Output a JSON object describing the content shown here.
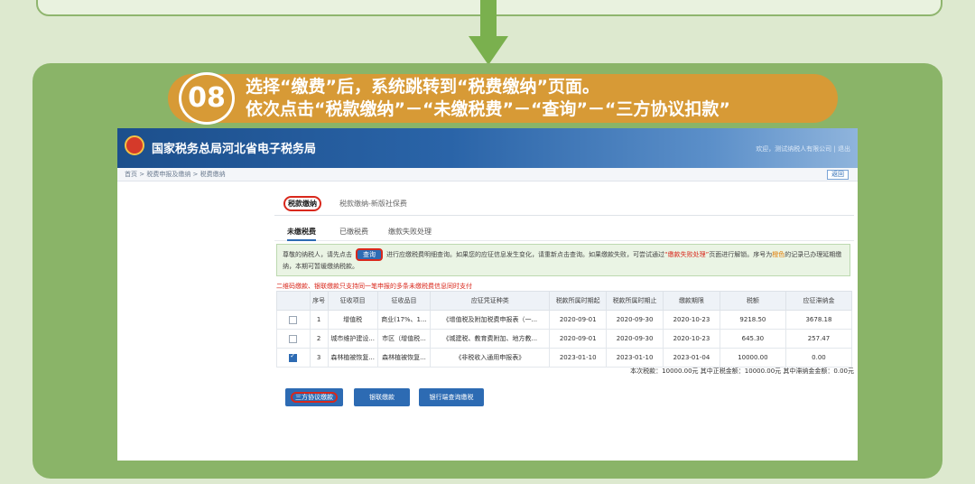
{
  "step": {
    "number": "08",
    "line1": "选择“缴费”后，系统跳转到“税费缴纳”页面。",
    "line2": "依次点击“税款缴纳”－“未缴税费”－“查询”－“三方协议扣款”"
  },
  "header": {
    "title": "国家税务总局河北省电子税务局",
    "user_info": "欢迎，测试纳税人有限公司 | 退出"
  },
  "breadcrumb": {
    "text": "首页 > 税费申报及缴纳 > 税费缴纳",
    "return_label": "返回"
  },
  "tabs_primary": [
    "税款缴纳",
    "税款缴纳-新版社保费"
  ],
  "tabs_secondary": [
    "未缴税费",
    "已缴税费",
    "缴款失败处理"
  ],
  "notice": {
    "part1": "尊敬的纳税人，请先点击",
    "query_button": "查询",
    "part2": "进行应缴税费明细查询。如果您的应征信息发生变化，请重新点击查询。如果缴款失败，可尝试通过",
    "link": "“缴款失败处理”",
    "part3": "页面进行解锁。序号为",
    "highlight": "橙色",
    "part4": "的记录已办理延期缴纳，本期可暂缓缴纳税款。"
  },
  "warning": "二维码缴款、银联缴款只支持同一笔申报的多条未缴税费信息同时支付",
  "table": {
    "headers": [
      "",
      "序号",
      "征收项目",
      "征收品目",
      "应征凭证种类",
      "税款所属时期起",
      "税款所属时期止",
      "缴款期限",
      "税额",
      "应征滞纳金"
    ],
    "rows": [
      {
        "checked": false,
        "no": "1",
        "item": "增值税",
        "subitem": "商业(17%、1...",
        "voucher": "《增值税及附加税费申报表（一...",
        "start": "2020-09-01",
        "end": "2020-09-30",
        "deadline": "2020-10-23",
        "tax": "9218.50",
        "late_fee": "3678.18"
      },
      {
        "checked": false,
        "no": "2",
        "item": "城市维护建设...",
        "subitem": "市区（增值税...",
        "voucher": "《城建税、教育费附加、地方教...",
        "start": "2020-09-01",
        "end": "2020-09-30",
        "deadline": "2020-10-23",
        "tax": "645.30",
        "late_fee": "257.47"
      },
      {
        "checked": true,
        "no": "3",
        "item": "森林植被恢复...",
        "subitem": "森林植被恢复...",
        "voucher": "《非税收入通用申报表》",
        "start": "2023-01-10",
        "end": "2023-01-10",
        "deadline": "2023-01-04",
        "tax": "10000.00",
        "late_fee": "0.00"
      }
    ]
  },
  "summary": "本次税款：10000.00元  其中正税金额：10000.00元  其中滞纳金金额：0.00元",
  "buttons": {
    "tripartite": "三方协议缴款",
    "unionpay": "银联缴款",
    "bank_counter": "银行端查询缴税"
  },
  "colors": {
    "background": "#dde9cf",
    "panel": "#8ab468",
    "banner": "#d79a36",
    "header_blue": "#1c4f8c",
    "button_blue": "#2d6bb3",
    "highlight_red": "#d9281c"
  }
}
